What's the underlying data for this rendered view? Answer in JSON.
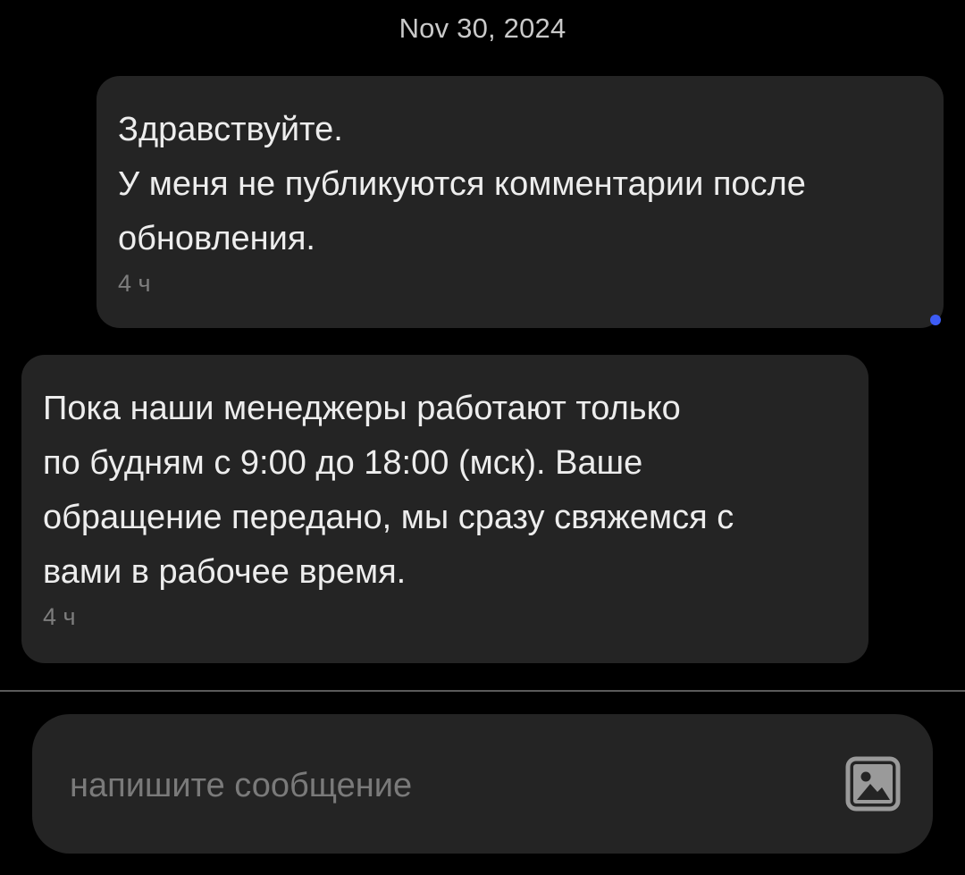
{
  "conversation": {
    "date_label": "Nov 30, 2024",
    "messages": [
      {
        "direction": "outgoing",
        "text": "Здравствуйте.\nУ меня не публикуются комментарии после\nобновления.",
        "time": "4 ч",
        "status_color": "#3d5cf5"
      },
      {
        "direction": "incoming",
        "text": "Пока наши менеджеры работают только\nпо будням с 9:00 до 18:00 (мск). Ваше\nобращение передано, мы сразу свяжемся с\nвами в рабочее время.",
        "time": "4 ч"
      }
    ]
  },
  "composer": {
    "placeholder": "напишите сообщение",
    "value": "",
    "attach_icon": "image-icon"
  },
  "colors": {
    "background": "#000000",
    "bubble": "#242424",
    "text": "#ededed",
    "muted_text": "#7d7d7d",
    "accent": "#3d5cf5"
  }
}
